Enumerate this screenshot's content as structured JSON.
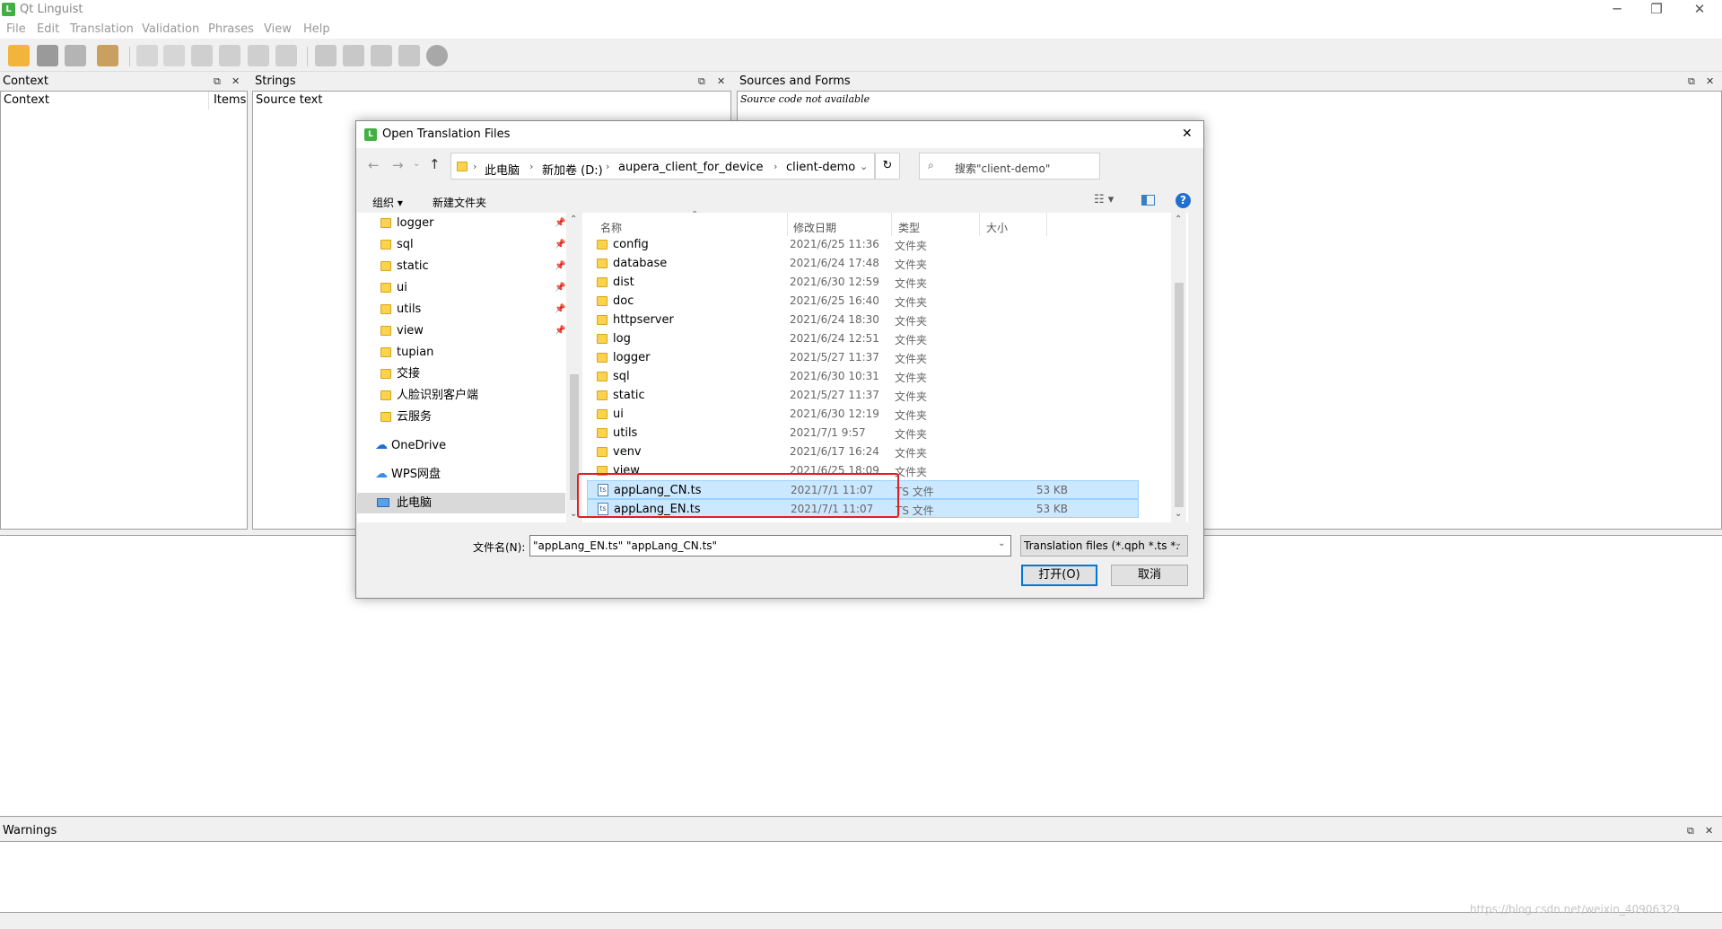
{
  "window": {
    "title": "Qt Linguist",
    "icon_letter": "L",
    "controls": {
      "minimize": "─",
      "restore": "❐",
      "close": "✕"
    }
  },
  "menu": [
    "File",
    "Edit",
    "Translation",
    "Validation",
    "Phrases",
    "View",
    "Help"
  ],
  "toolbar_icons": [
    "open-icon",
    "save-icon",
    "print-icon",
    "phrasebook-icon",
    "prev-icon",
    "next-icon",
    "prev-unfinished-icon",
    "next-unfinished-icon",
    "done-next-icon",
    "done-icon",
    "accelerator-icon",
    "surrounding-whitespace-icon",
    "punctuation-icon",
    "phrase-match-icon",
    "place-marker-icon"
  ],
  "panels": {
    "context": {
      "title": "Context",
      "col1": "Context",
      "col2": "Items"
    },
    "strings": {
      "title": "Strings",
      "col1": "Source text"
    },
    "sources": {
      "title": "Sources and Forms",
      "note": "Source code not available"
    },
    "warnings": {
      "title": "Warnings"
    },
    "float_glyph": "⧉",
    "close_glyph": "✕"
  },
  "dialog": {
    "title": "Open Translation Files",
    "breadcrumb": [
      "此电脑",
      "新加卷 (D:)",
      "aupera_client_for_device",
      "client-demo"
    ],
    "search_placeholder": "搜索\"client-demo\"",
    "organize": "组织 ▾",
    "new_folder": "新建文件夹",
    "headers": {
      "name": "名称",
      "date": "修改日期",
      "type": "类型",
      "size": "大小"
    },
    "nav_folders": [
      {
        "name": "logger",
        "pinned": true
      },
      {
        "name": "sql",
        "pinned": true
      },
      {
        "name": "static",
        "pinned": true
      },
      {
        "name": "ui",
        "pinned": true
      },
      {
        "name": "utils",
        "pinned": true
      },
      {
        "name": "view",
        "pinned": true
      },
      {
        "name": "tupian",
        "pinned": false
      },
      {
        "name": "交接",
        "pinned": false
      },
      {
        "name": "人脸识别客户端",
        "pinned": false
      },
      {
        "name": "云服务",
        "pinned": false
      }
    ],
    "nav_locations": [
      "OneDrive",
      "WPS网盘",
      "此电脑"
    ],
    "files": [
      {
        "name": "config",
        "date": "2021/6/25 11:36",
        "type": "文件夹",
        "size": "",
        "kind": "folder"
      },
      {
        "name": "database",
        "date": "2021/6/24 17:48",
        "type": "文件夹",
        "size": "",
        "kind": "folder"
      },
      {
        "name": "dist",
        "date": "2021/6/30 12:59",
        "type": "文件夹",
        "size": "",
        "kind": "folder"
      },
      {
        "name": "doc",
        "date": "2021/6/25 16:40",
        "type": "文件夹",
        "size": "",
        "kind": "folder"
      },
      {
        "name": "httpserver",
        "date": "2021/6/24 18:30",
        "type": "文件夹",
        "size": "",
        "kind": "folder"
      },
      {
        "name": "log",
        "date": "2021/6/24 12:51",
        "type": "文件夹",
        "size": "",
        "kind": "folder"
      },
      {
        "name": "logger",
        "date": "2021/5/27 11:37",
        "type": "文件夹",
        "size": "",
        "kind": "folder"
      },
      {
        "name": "sql",
        "date": "2021/6/30 10:31",
        "type": "文件夹",
        "size": "",
        "kind": "folder"
      },
      {
        "name": "static",
        "date": "2021/5/27 11:37",
        "type": "文件夹",
        "size": "",
        "kind": "folder"
      },
      {
        "name": "ui",
        "date": "2021/6/30 12:19",
        "type": "文件夹",
        "size": "",
        "kind": "folder"
      },
      {
        "name": "utils",
        "date": "2021/7/1 9:57",
        "type": "文件夹",
        "size": "",
        "kind": "folder"
      },
      {
        "name": "venv",
        "date": "2021/6/17 16:24",
        "type": "文件夹",
        "size": "",
        "kind": "folder"
      },
      {
        "name": "view",
        "date": "2021/6/25 18:09",
        "type": "文件夹",
        "size": "",
        "kind": "folder"
      },
      {
        "name": "appLang_CN.ts",
        "date": "2021/7/1 11:07",
        "type": "TS 文件",
        "size": "53 KB",
        "kind": "ts",
        "selected": true
      },
      {
        "name": "appLang_EN.ts",
        "date": "2021/7/1 11:07",
        "type": "TS 文件",
        "size": "53 KB",
        "kind": "ts",
        "selected": true
      }
    ],
    "filename_label": "文件名(N):",
    "filename_value": "\"appLang_EN.ts\" \"appLang_CN.ts\"",
    "filter_value": "Translation files (*.qph *.ts *.",
    "open_button": "打开(O)",
    "cancel_button": "取消",
    "highlight_color": "#e02020"
  },
  "watermark": "https://blog.csdn.net/weixin_40906329"
}
